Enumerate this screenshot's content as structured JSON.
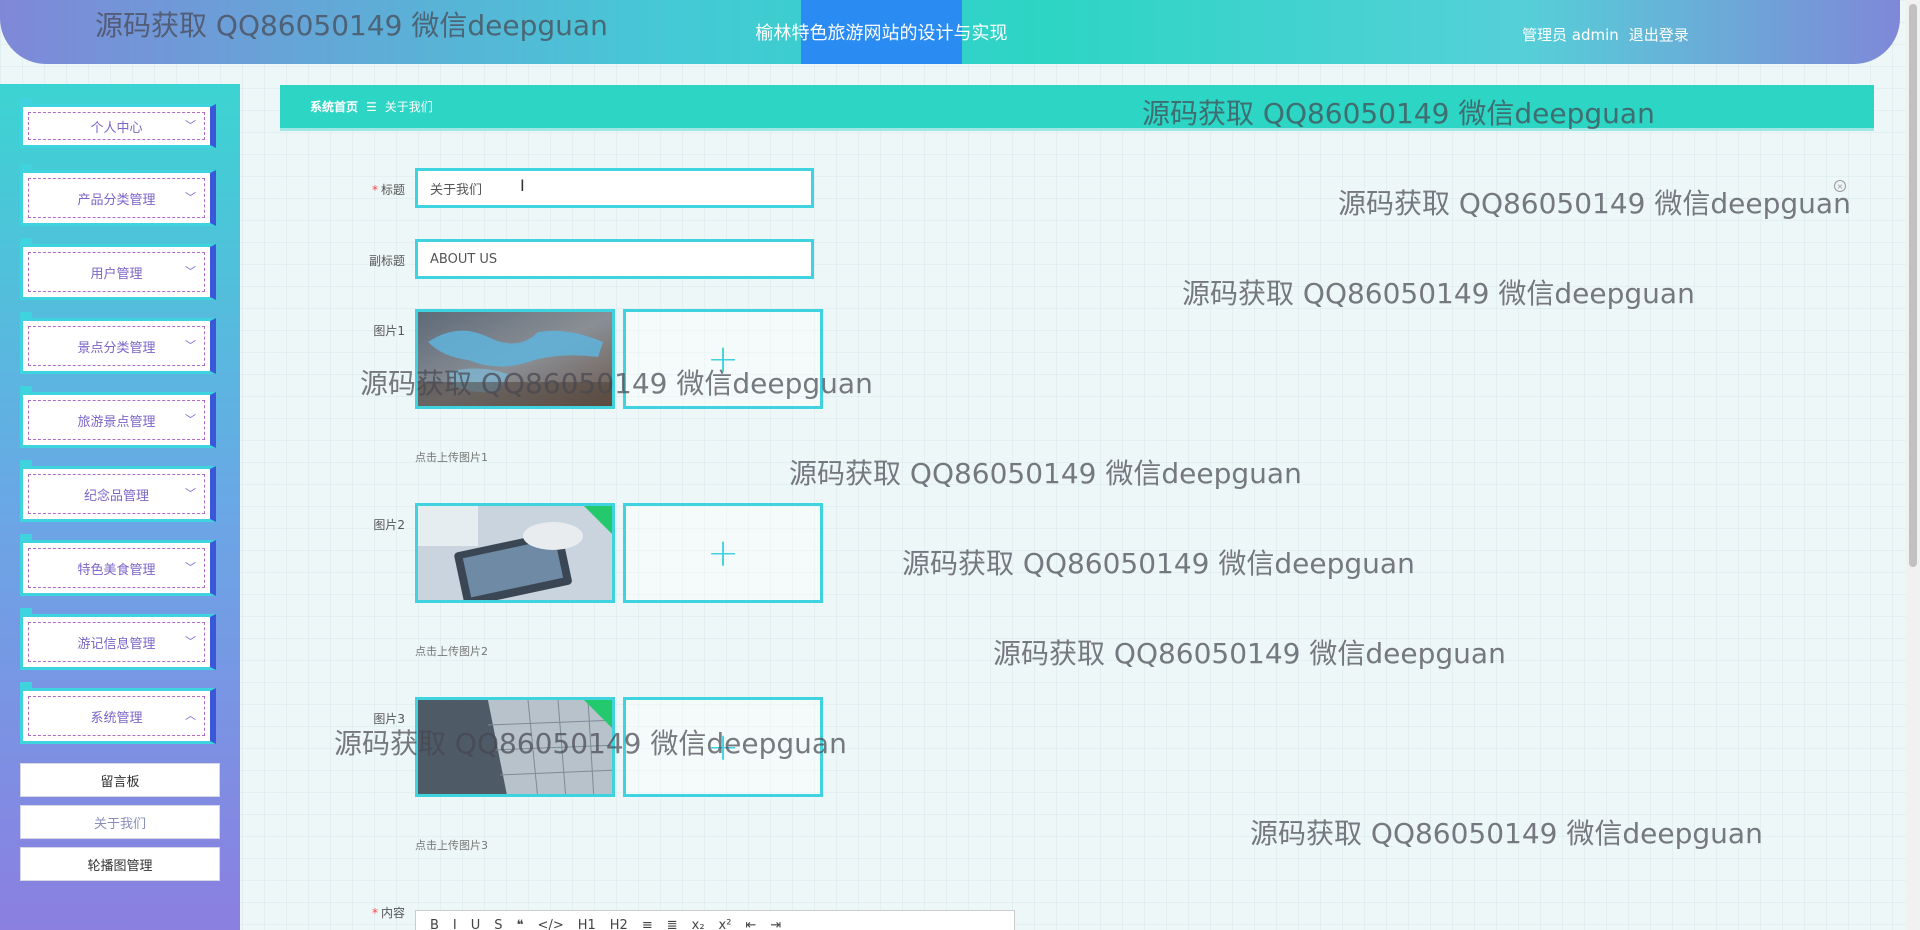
{
  "header": {
    "site_title": "榆林特色旅游网站的设计与实现",
    "role": "管理员 admin",
    "logout": "退出登录"
  },
  "sidebar": {
    "items": [
      {
        "label": "个人中心"
      },
      {
        "label": "产品分类管理"
      },
      {
        "label": "用户管理"
      },
      {
        "label": "景点分类管理"
      },
      {
        "label": "旅游景点管理"
      },
      {
        "label": "纪念品管理"
      },
      {
        "label": "特色美食管理"
      },
      {
        "label": "游记信息管理"
      },
      {
        "label": "系统管理"
      }
    ],
    "sub_items": [
      {
        "label": "留言板"
      },
      {
        "label": "关于我们"
      },
      {
        "label": "轮播图管理"
      }
    ]
  },
  "breadcrumb": {
    "home": "系统首页",
    "separator": "☰",
    "current": "关于我们"
  },
  "form": {
    "title_label": "标题",
    "title_value": "关于我们",
    "subtitle_label": "副标题",
    "subtitle_value": "ABOUT US",
    "images": [
      {
        "label": "图片1",
        "tip": "点击上传图片1"
      },
      {
        "label": "图片2",
        "tip": "点击上传图片2"
      },
      {
        "label": "图片3",
        "tip": "点击上传图片3"
      }
    ],
    "content_label": "内容",
    "upload_plus": "+"
  },
  "editor": {
    "tools": [
      "B",
      "I",
      "U",
      "S",
      "❝",
      "</>",
      "H1",
      "H2",
      "≡",
      "≣",
      "x₂",
      "x²",
      "⇤",
      "⇥"
    ]
  },
  "watermark": {
    "text": "源码获取 QQ86050149 微信deepguan"
  },
  "colors": {
    "accent": "#2cd5c4",
    "border": "#3ed3de",
    "title_bg": "#2a8cf2",
    "required": "#f44444"
  }
}
